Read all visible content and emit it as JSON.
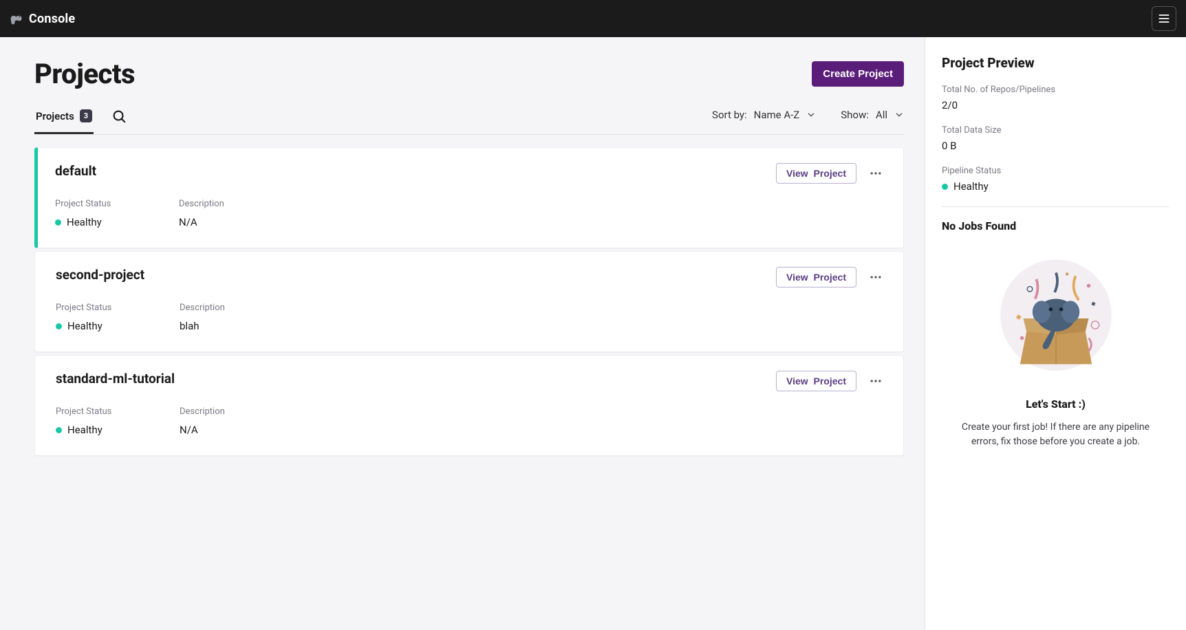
{
  "header": {
    "brand": "Console"
  },
  "page": {
    "title": "Projects",
    "create_button": "Create Project",
    "tab_label": "Projects",
    "tab_count": "3",
    "sort_label_prefix": "Sort by:",
    "sort_value": "Name A-Z",
    "show_label_prefix": "Show:",
    "show_value": "All",
    "view_button": "View  Project"
  },
  "fields": {
    "status": "Project Status",
    "description": "Description"
  },
  "projects": [
    {
      "name": "default",
      "status": "Healthy",
      "description": "N/A",
      "selected": true
    },
    {
      "name": "second-project",
      "status": "Healthy",
      "description": "blah",
      "selected": false
    },
    {
      "name": "standard-ml-tutorial",
      "status": "Healthy",
      "description": "N/A",
      "selected": false
    }
  ],
  "preview": {
    "title": "Project Preview",
    "repos_label": "Total No. of Repos/Pipelines",
    "repos_value": "2/0",
    "datasize_label": "Total Data Size",
    "datasize_value": "0 B",
    "pipeline_status_label": "Pipeline Status",
    "pipeline_status_value": "Healthy",
    "no_jobs_title": "No Jobs Found",
    "empty_title": "Let's Start :)",
    "empty_desc": "Create your first job! If there are any pipeline errors, fix those before you create a job."
  },
  "colors": {
    "accent": "#5a1e7a",
    "healthy": "#17c7a6"
  }
}
